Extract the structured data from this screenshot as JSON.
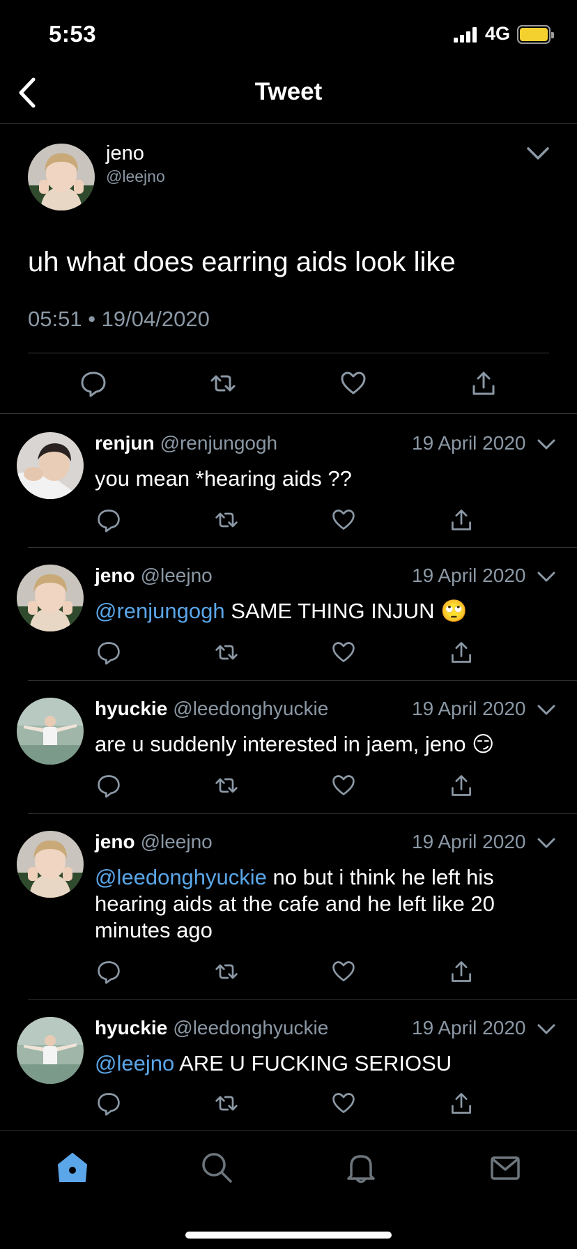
{
  "status_bar": {
    "time": "5:53",
    "network": "4G",
    "battery_color": "#f5d130"
  },
  "header": {
    "title": "Tweet"
  },
  "main_tweet": {
    "name": "jeno",
    "handle": "@leejno",
    "text": "uh what does earring aids look like",
    "timestamp": "05:51 • 19/04/2020"
  },
  "replies": [
    {
      "name": "renjun",
      "handle": "@renjungogh",
      "date": "19 April 2020",
      "mention": "",
      "text": "you mean *hearing aids ??",
      "emoji": ""
    },
    {
      "name": "jeno",
      "handle": "@leejno",
      "date": "19 April 2020",
      "mention": "@renjungogh",
      "text": " SAME THING INJUN ",
      "emoji": "🙄"
    },
    {
      "name": "hyuckie",
      "handle": "@leedonghyuckie",
      "date": "19 April 2020",
      "mention": "",
      "text": "are u suddenly interested in jaem, jeno ",
      "emoji": "😏"
    },
    {
      "name": "jeno",
      "handle": "@leejno",
      "date": "19 April 2020",
      "mention": "@leedonghyuckie",
      "text": " no but i think he left his hearing aids at the cafe and he left like 20 minutes ago",
      "emoji": ""
    },
    {
      "name": "hyuckie",
      "handle": "@leedonghyuckie",
      "date": "19 April 2020",
      "mention": "@leejno",
      "text": " ARE U FUCKING SERIOSU",
      "emoji": ""
    }
  ],
  "tab_bar": {
    "active": "home",
    "accent": "#5aa6e8"
  }
}
